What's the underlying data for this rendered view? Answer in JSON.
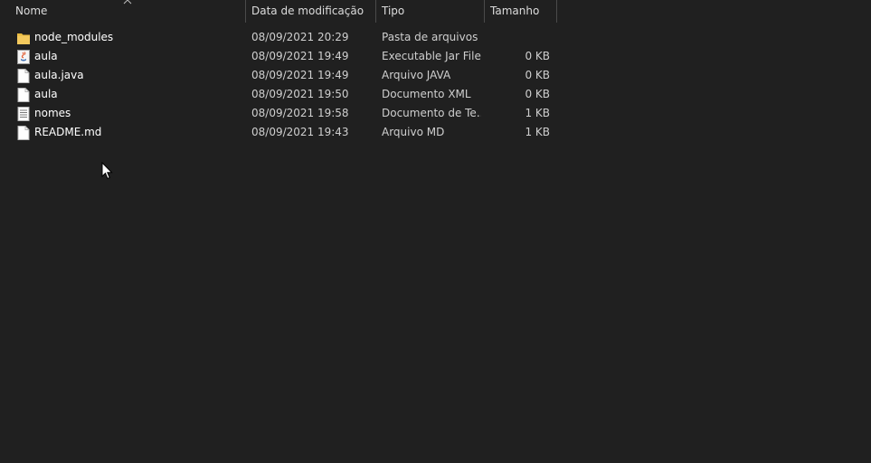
{
  "columns": {
    "name": "Nome",
    "date": "Data de modificação",
    "type": "Tipo",
    "size": "Tamanho"
  },
  "files": [
    {
      "icon": "folder-icon",
      "name": "node_modules",
      "date": "08/09/2021 20:29",
      "type": "Pasta de arquivos",
      "size": ""
    },
    {
      "icon": "java-jar-icon",
      "name": "aula",
      "date": "08/09/2021 19:49",
      "type": "Executable Jar File",
      "size": "0 KB"
    },
    {
      "icon": "file-icon",
      "name": "aula.java",
      "date": "08/09/2021 19:49",
      "type": "Arquivo JAVA",
      "size": "0 KB"
    },
    {
      "icon": "file-icon",
      "name": "aula",
      "date": "08/09/2021 19:50",
      "type": "Documento XML",
      "size": "0 KB"
    },
    {
      "icon": "text-file-icon",
      "name": "nomes",
      "date": "08/09/2021 19:58",
      "type": "Documento de Te...",
      "size": "1 KB"
    },
    {
      "icon": "file-icon",
      "name": "README.md",
      "date": "08/09/2021 19:43",
      "type": "Arquivo MD",
      "size": "1 KB"
    }
  ],
  "colors": {
    "background": "#202020",
    "folder": "#f4c95d",
    "text": "#ffffff"
  }
}
